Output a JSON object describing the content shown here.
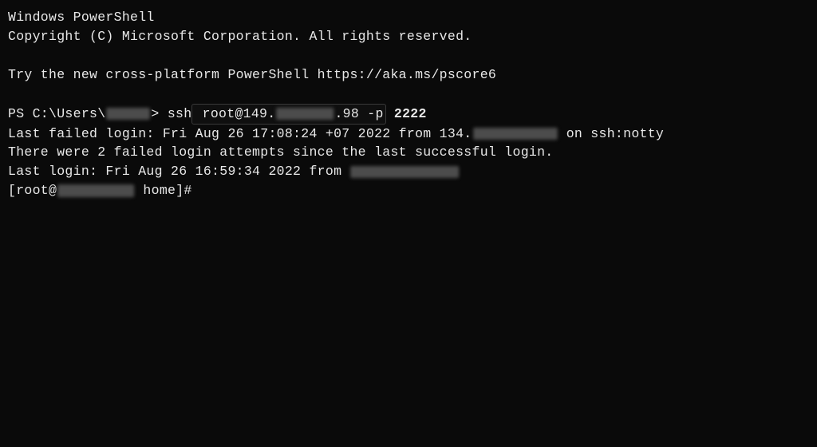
{
  "header": {
    "line1": "Windows PowerShell",
    "line2": "Copyright (C) Microsoft Corporation. All rights reserved.",
    "line3": "Try the new cross-platform PowerShell https://aka.ms/pscore6"
  },
  "prompt": {
    "ps_prefix": "PS C:\\Users\\",
    "ps_suffix": "> ",
    "cmd_ssh": "ssh",
    "cmd_user_at_ip_a": " root@149.",
    "cmd_user_at_ip_b": ".98 -",
    "cmd_flag": "p",
    "cmd_port": " 2222"
  },
  "ssh_output": {
    "last_failed_a": "Last failed login: Fri Aug 26 17:08:24 +07 2022 from 134.",
    "last_failed_b": " on ssh:notty",
    "failed_attempts": "There were 2 failed login attempts since the last successful login.",
    "last_login_a": "Last login: Fri Aug 26 16:59:34 2022 from "
  },
  "remote_prompt": {
    "prefix": "[root@",
    "suffix": " home]#"
  },
  "redact_widths": {
    "user": 55,
    "ip_mid": 72,
    "ip_tail": 106,
    "from_ip": 136,
    "hostname": 96
  }
}
